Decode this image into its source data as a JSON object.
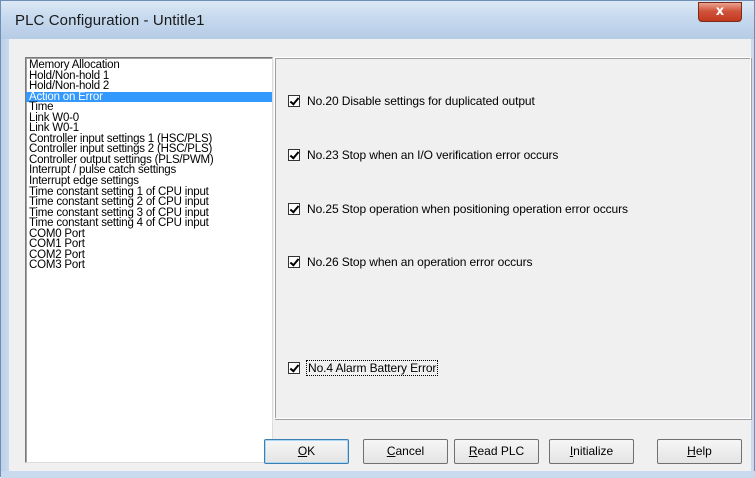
{
  "window": {
    "title": "PLC Configuration - Untitle1",
    "close_glyph": "x"
  },
  "sidebar": {
    "items": [
      "Memory Allocation",
      "Hold/Non-hold 1",
      "Hold/Non-hold 2",
      "Action on Error",
      "Time",
      "Link W0-0",
      "Link W0-1",
      "Controller input settings 1 (HSC/PLS)",
      "Controller input settings 2 (HSC/PLS)",
      "Controller output settings (PLS/PWM)",
      "Interrupt / pulse catch settings",
      "Interrupt edge settings",
      "Time constant setting 1 of CPU input",
      "Time constant setting 2 of CPU input",
      "Time constant setting 3 of CPU input",
      "Time constant setting 4 of CPU input",
      "COM0 Port",
      "COM1 Port",
      "COM2 Port",
      "COM3 Port"
    ],
    "selected": "Action on Error"
  },
  "options": [
    {
      "label": "No.20 Disable settings for duplicated output",
      "checked": true
    },
    {
      "label": "No.23 Stop when an I/O verification error occurs",
      "checked": true
    },
    {
      "label": "No.25 Stop operation when positioning operation error occurs",
      "checked": true
    },
    {
      "label": "No.26 Stop when an operation error occurs",
      "checked": true
    },
    {
      "label": "No.4  Alarm Battery Error",
      "checked": true
    }
  ],
  "buttons": {
    "ok": {
      "first": "O",
      "rest": "K"
    },
    "cancel": {
      "first": "C",
      "rest": "ancel"
    },
    "read_plc": {
      "first": "R",
      "rest": "ead PLC"
    },
    "initialize": {
      "first": "I",
      "rest": "nitialize"
    },
    "help": {
      "first": "H",
      "rest": "elp"
    }
  },
  "colors": {
    "selection": "#3399ff",
    "close_button": "#c2391f"
  }
}
